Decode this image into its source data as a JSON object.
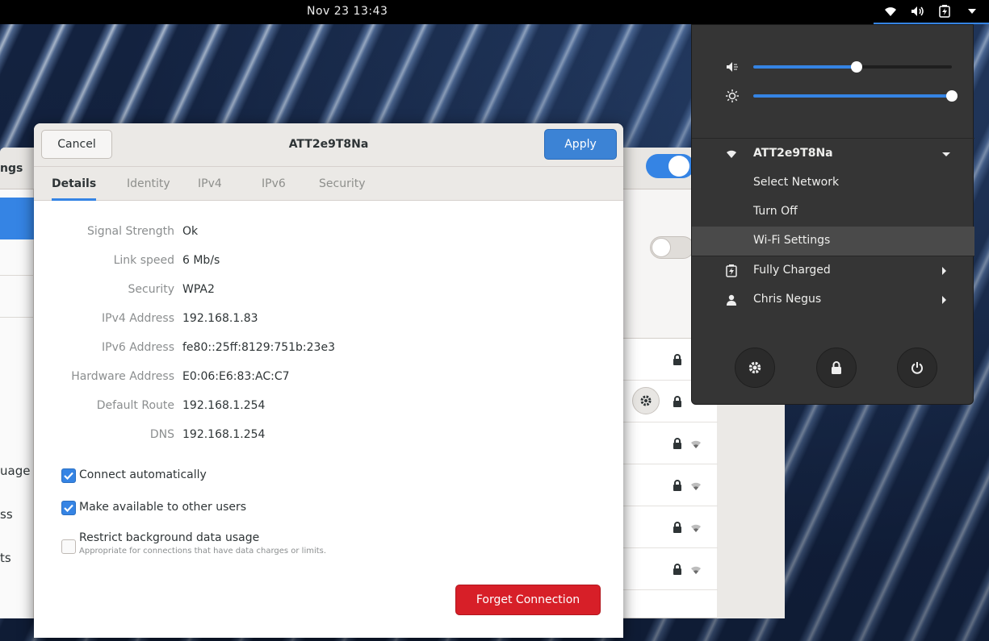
{
  "topbar": {
    "clock": "Nov 23  13:43",
    "icons": [
      "wifi-icon",
      "volume-icon",
      "battery-icon",
      "menu-arrow-icon"
    ]
  },
  "settings_window": {
    "title": "ngs",
    "sidebar_items": [
      "uage",
      "ss",
      "ts"
    ]
  },
  "dialog": {
    "cancel_label": "Cancel",
    "title": "ATT2e9T8Na",
    "apply_label": "Apply",
    "tabs": [
      "Details",
      "Identity",
      "IPv4",
      "IPv6",
      "Security"
    ],
    "active_tab": "Details",
    "details": [
      {
        "label": "Signal Strength",
        "value": "Ok"
      },
      {
        "label": "Link speed",
        "value": "6 Mb/s"
      },
      {
        "label": "Security",
        "value": "WPA2"
      },
      {
        "label": "IPv4 Address",
        "value": "192.168.1.83"
      },
      {
        "label": "IPv6 Address",
        "value": "fe80::25ff:8129:751b:23e3"
      },
      {
        "label": "Hardware Address",
        "value": "E0:06:E6:83:AC:C7"
      },
      {
        "label": "Default Route",
        "value": "192.168.1.254"
      },
      {
        "label": "DNS",
        "value": "192.168.1.254"
      }
    ],
    "options": {
      "connect_automatically": {
        "label": "Connect automatically",
        "checked": true
      },
      "available_to_others": {
        "label": "Make available to other users",
        "checked": true
      },
      "restrict_background": {
        "label": "Restrict background data usage",
        "sublabel": "Appropriate for connections that have data charges or limits.",
        "checked": false
      }
    },
    "forget_label": "Forget Connection"
  },
  "system_menu": {
    "volume_level": 0.52,
    "brightness_level": 1.0,
    "network_name": "ATT2e9T8Na",
    "select_network": "Select Network",
    "turn_off": "Turn Off",
    "wifi_settings": "Wi-Fi Settings",
    "battery_status": "Fully Charged",
    "user_name": "Chris Negus"
  },
  "colors": {
    "accent": "#3584e4",
    "destructive": "#d71f28",
    "menu_bg": "#353535"
  }
}
